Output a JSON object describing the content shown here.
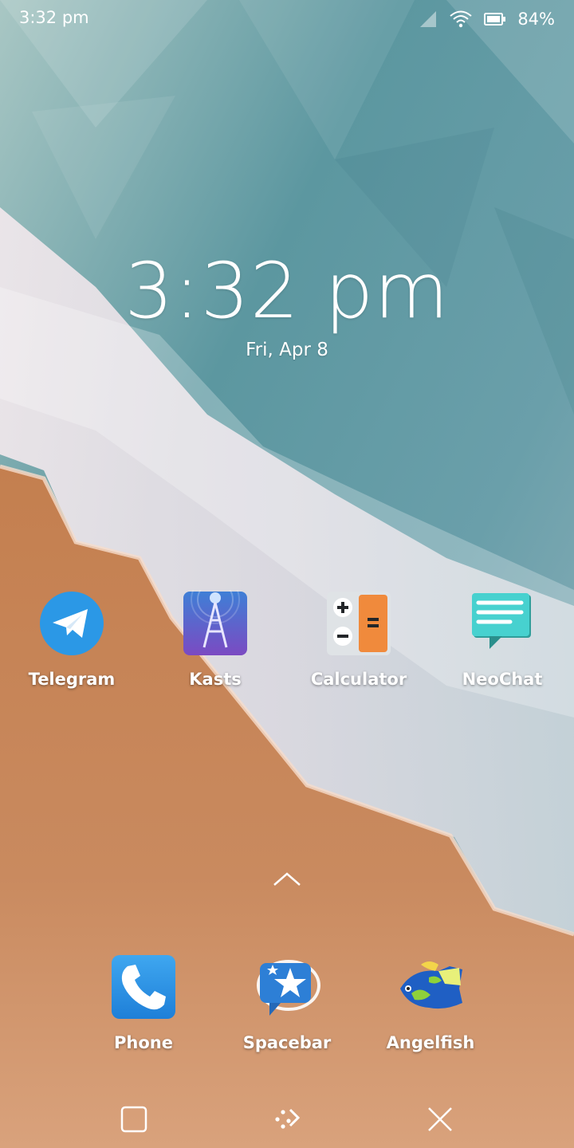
{
  "status_bar": {
    "time": "3:32 pm",
    "battery_percent": "84%",
    "icons": [
      "cellular-signal-icon",
      "wifi-icon",
      "battery-icon"
    ]
  },
  "clock": {
    "time": "3:32 pm",
    "date": "Fri, Apr 8"
  },
  "favorites": [
    {
      "label": "Telegram",
      "icon": "telegram-icon"
    },
    {
      "label": "Kasts",
      "icon": "kasts-icon"
    },
    {
      "label": "Calculator",
      "icon": "calculator-icon"
    },
    {
      "label": "NeoChat",
      "icon": "neochat-icon"
    }
  ],
  "dock": [
    {
      "label": "Phone",
      "icon": "phone-icon"
    },
    {
      "label": "Spacebar",
      "icon": "spacebar-icon"
    },
    {
      "label": "Angelfish",
      "icon": "angelfish-icon"
    }
  ],
  "drawer_handle_icon": "chevron-up-icon",
  "nav_bar": {
    "icons": [
      "task-switcher-icon",
      "home-icon",
      "close-icon"
    ]
  },
  "colors": {
    "sand": "#c98a5c",
    "sky": "#5f9aa5",
    "foam": "#ece6ea",
    "text": "#ffffff"
  }
}
